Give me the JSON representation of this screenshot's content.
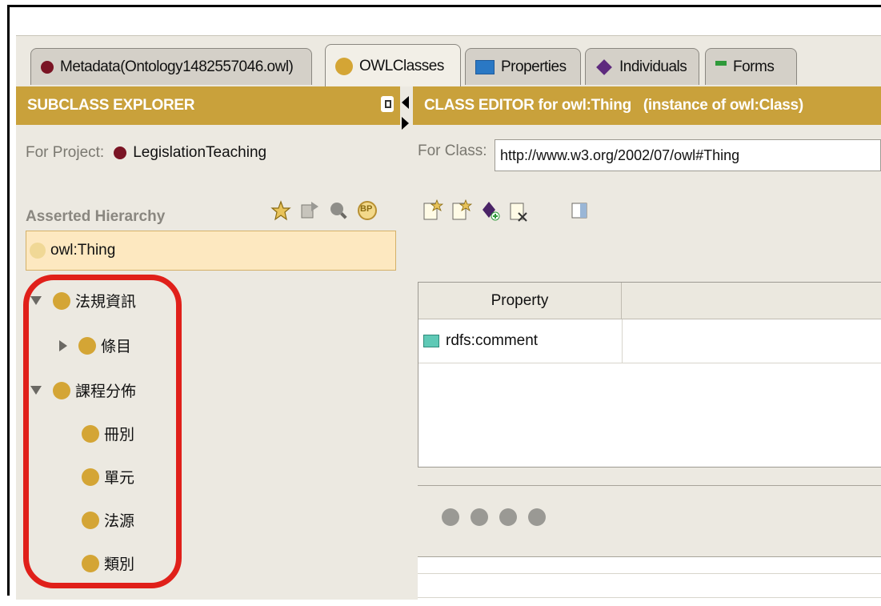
{
  "tabs": [
    {
      "label": "Metadata(Ontology1482557046.owl)",
      "icon": "red-circle-icon"
    },
    {
      "label": "OWLClasses",
      "icon": "gold-circle-icon",
      "active": true
    },
    {
      "label": "Properties",
      "icon": "blue-square-icon"
    },
    {
      "label": "Individuals",
      "icon": "purple-diamond-icon"
    },
    {
      "label": "Forms",
      "icon": "forms-icon"
    }
  ],
  "subclass_explorer": {
    "header": "SUBCLASS EXPLORER",
    "project_label": "For Project:",
    "project_name": "LegislationTeaching",
    "hierarchy_label": "Asserted Hierarchy",
    "bp_label": "BP",
    "root": "owl:Thing",
    "tree": [
      {
        "label": "法規資訊",
        "expanded": true
      },
      {
        "label": "條目",
        "collapsed": true
      },
      {
        "label": "課程分佈",
        "expanded": true
      },
      {
        "label": "冊別"
      },
      {
        "label": "單元"
      },
      {
        "label": "法源"
      },
      {
        "label": "類別"
      }
    ]
  },
  "class_editor": {
    "header": "CLASS EDITOR for owl:Thing   (instance of owl:Class)",
    "class_label": "For Class:",
    "class_value": "http://www.w3.org/2002/07/owl#Thing",
    "table_header": [
      "Property",
      ""
    ],
    "rows": [
      {
        "property": "rdfs:comment",
        "value": ""
      }
    ]
  },
  "colors": {
    "accent": "#c9a13b",
    "highlight_box": "#e0201a"
  }
}
